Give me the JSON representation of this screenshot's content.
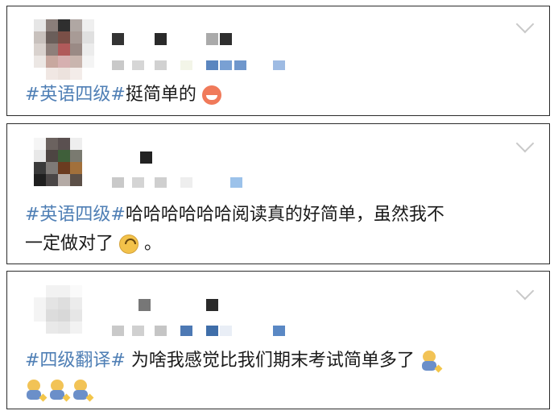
{
  "posts": [
    {
      "hashtag": "#英语四级#",
      "content": "挺简单的",
      "emoji": "clown-face-icon"
    },
    {
      "hashtag": "#英语四级#",
      "content": "哈哈哈哈哈哈阅读真的好简单，虽然我不",
      "content2": "一定做对了",
      "after_emoji": "。",
      "emoji": "upside-down-face-icon"
    },
    {
      "hashtag": "#四级翻译#",
      "content": " 为啥我感觉比我们期末考试简单多了",
      "emoji": "sweat-smile-figure-icon"
    }
  ],
  "colors": {
    "hashtag": "#4f7fb5",
    "text": "#1a1a1a",
    "border": "#2b2b2b",
    "chevron": "#c9c9c9"
  }
}
